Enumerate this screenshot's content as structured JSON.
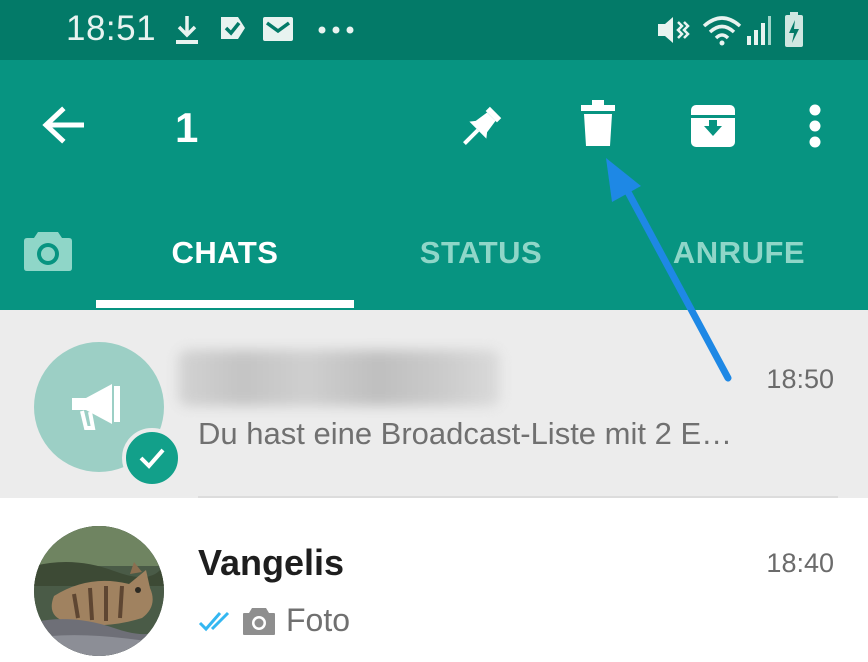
{
  "status_bar": {
    "time": "18:51",
    "left_icons": [
      "download-icon",
      "flag-icon",
      "mail-icon",
      "more-dots-icon"
    ],
    "right_icons": [
      "mute-vibrate-icon",
      "wifi-icon",
      "signal-icon",
      "battery-charging-icon"
    ]
  },
  "app_bar": {
    "selection_count": "1",
    "actions": [
      "back-arrow-icon",
      "pin-icon",
      "delete-icon",
      "archive-icon",
      "overflow-menu-icon"
    ]
  },
  "tabs": [
    {
      "label": "CHATS",
      "active": true
    },
    {
      "label": "STATUS",
      "active": false
    },
    {
      "label": "ANRUFE",
      "active": false
    }
  ],
  "chats": [
    {
      "name": "",
      "time": "18:50",
      "preview": "Du hast eine Broadcast-Liste mit 2 E…",
      "selected": true,
      "avatar": "broadcast-megaphone-icon"
    },
    {
      "name": "Vangelis",
      "time": "18:40",
      "preview": "Foto",
      "selected": false,
      "avatar": "cat-photo"
    }
  ],
  "colors": {
    "status_bar": "#037a68",
    "app_bar": "#079481",
    "accent": "#12a08a",
    "selected_row": "#ececec",
    "read_ticks": "#34b7f1",
    "annotation_arrow": "#1e88e5"
  },
  "annotation": {
    "points_to": "delete-icon"
  }
}
